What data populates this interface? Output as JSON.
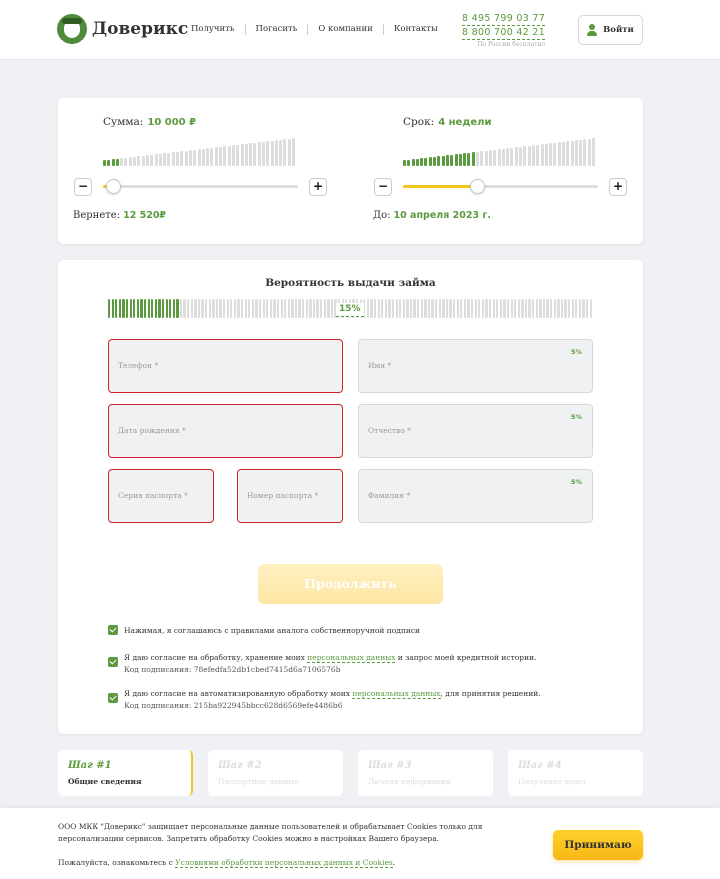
{
  "header": {
    "logo_text": "Доверикс",
    "nav": [
      "Получить",
      "Погасить",
      "О компании",
      "Контакты"
    ],
    "phone1": "8 495 799 03 77",
    "phone2": "8 800 700 42 21",
    "phone_note": "По России бесплатно",
    "login_label": "Войти"
  },
  "calculator": {
    "amount_label": "Сумма:",
    "amount_value": "10 000 ₽",
    "amount_fraction": 0.05,
    "return_label": "Вернете:",
    "return_value": "12 520₽",
    "term_label": "Срок:",
    "term_value": "4 недели",
    "term_fraction": 0.38,
    "until_label": "До:",
    "until_value": "10 апреля 2023 г.",
    "minus": "−",
    "plus": "+"
  },
  "form": {
    "probability_title": "Вероятность выдачи займа",
    "probability_value": "15%",
    "probability_fraction": 0.15,
    "fields": {
      "phone": {
        "placeholder": "Телефон *"
      },
      "birth": {
        "placeholder": "Дата рождения *"
      },
      "pass_series": {
        "placeholder": "Серия паспорта *"
      },
      "pass_number": {
        "placeholder": "Номер паспорта *"
      },
      "name": {
        "placeholder": "Имя *",
        "badge": "5%"
      },
      "patronymic": {
        "placeholder": "Отчество *",
        "badge": "5%"
      },
      "surname": {
        "placeholder": "Фамилия *",
        "badge": "5%"
      }
    },
    "continue_label": "Продолжить",
    "agree1": "Нажимая, я соглашаюсь с правилами аналога собственноручной подписи",
    "agree2_pre": "Я даю согласие на обработку, хранение моих ",
    "agree2_link": "персональных данных",
    "agree2_post": " и запрос моей кредитной истории.",
    "agree2_code": "Код подписания: 78efedfa52db1cbed7415d6a7106576b",
    "agree3_pre": "Я даю согласие на автоматизированную обработку моих ",
    "agree3_link": "персональных данных",
    "agree3_post": ", для принятия решений.",
    "agree3_code": "Код подписания: 215ba922945bbcc628d6569efe4486b6"
  },
  "steps": [
    {
      "number": "Шаг #1",
      "label": "Общие сведения"
    },
    {
      "number": "Шаг #2",
      "label": "Паспортные данные"
    },
    {
      "number": "Шаг #3",
      "label": "Личная информация"
    },
    {
      "number": "Шаг #4",
      "label": "Получение денег"
    }
  ],
  "cookie": {
    "text": "ООО МКК \"Доверикс\" защищает персональные данные пользователей и обрабатывает Cookies только для персонализации сервисов. Запретить обработку Cookies можно в настройках Вашего браузера.",
    "text2_pre": "Пожалуйста, ознакомьтесь с ",
    "text2_link": "Условиями обработки персональных данных и Cookies",
    "text2_post": ".",
    "accept_label": "Принимаю"
  }
}
